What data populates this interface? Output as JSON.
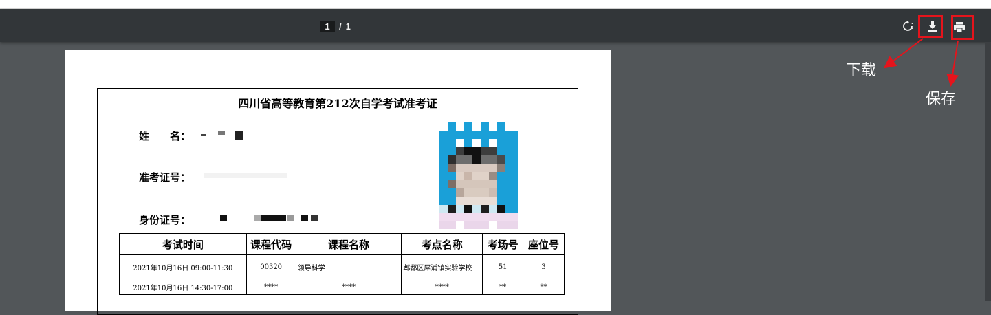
{
  "viewer": {
    "current_page": "1",
    "page_separator": "/",
    "total_pages": "1",
    "icons": {
      "rotate": "rotate-icon",
      "download": "download-icon",
      "print": "print-icon"
    },
    "highlight_color": "#e5141c"
  },
  "annotations": {
    "download_label": "下载",
    "save_label": "保存"
  },
  "document": {
    "title": "四川省高等教育第212次自学考试准考证",
    "name_label": "姓　　名：",
    "ticket_label": "准考证号：",
    "id_label": "身份证号：",
    "table": {
      "headers": [
        "考试时间",
        "课程代码",
        "课程名称",
        "考点名称",
        "考场号",
        "座位号"
      ],
      "rows": [
        [
          "2021年10月16日 09:00-11:30",
          "00320",
          "领导科学",
          "郫都区犀浦镇实验学校",
          "51",
          "3"
        ],
        [
          "2021年10月16日 14:30-17:00",
          "****",
          "****",
          "****",
          "**",
          "**"
        ]
      ]
    }
  }
}
